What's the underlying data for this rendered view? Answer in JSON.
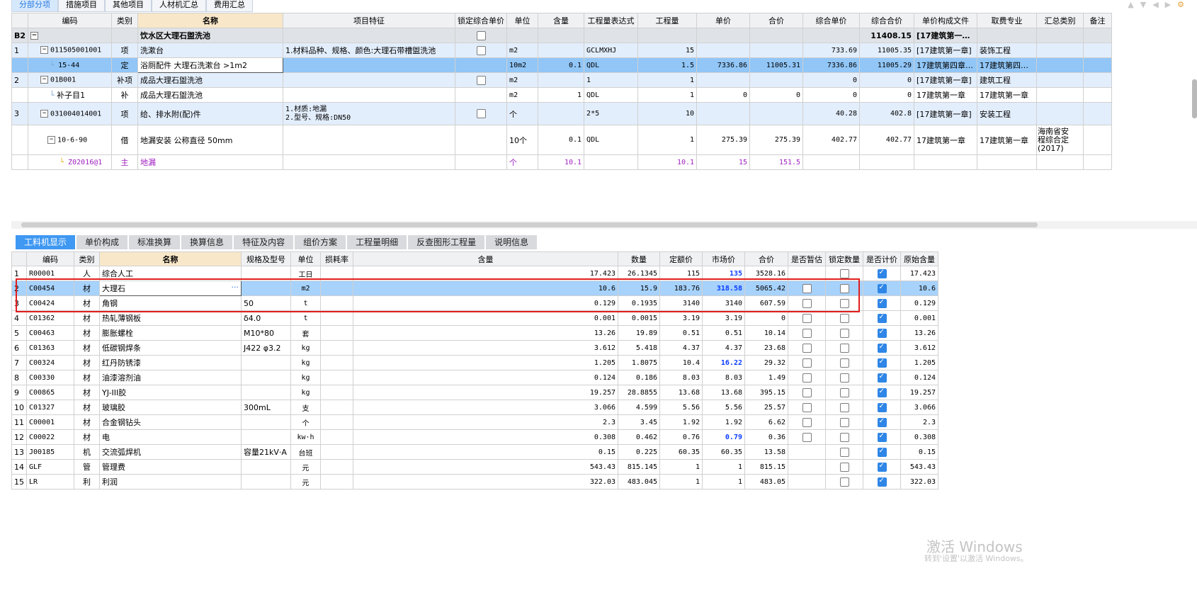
{
  "top_tabs": [
    "分部分项",
    "措施项目",
    "其他项目",
    "人材机汇总",
    "费用汇总"
  ],
  "top_table": {
    "headers": [
      "编码",
      "类别",
      "名称",
      "项目特征",
      "锁定综合单价",
      "单位",
      "含量",
      "工程量表达式",
      "工程量",
      "单价",
      "合价",
      "综合单价",
      "综合合价",
      "单价构成文件",
      "取费专业",
      "汇总类别",
      "备注"
    ],
    "group": {
      "idx": "B2",
      "name": "饮水区大理石盥洗池",
      "total": "11408.15",
      "file": "[17建筑第一…"
    },
    "rows": [
      {
        "idx": "1",
        "code": "011505001001",
        "type": "项",
        "name": "洗漱台",
        "feature": "1.材料品种、规格、颜色:大理石带槽盥洗池",
        "unit": "m2",
        "content": "",
        "expr": "GCLMXHJ",
        "qty": "15",
        "price": "",
        "total": "",
        "zh_price": "733.69",
        "zh_total": "11005.35",
        "file": "[17建筑第一章]",
        "major": "装饰工程",
        "note": ""
      },
      {
        "idx": "",
        "code": "15-44",
        "type": "定",
        "name": "浴厕配件 大理石洗漱台 >1m2",
        "feature": "",
        "unit": "10m2",
        "content": "0.1",
        "expr": "QDL",
        "qty": "1.5",
        "price": "7336.86",
        "total": "11005.31",
        "zh_price": "7336.86",
        "zh_total": "11005.29",
        "file": "17建筑第四章…",
        "major": "17建筑第四…",
        "note": ""
      },
      {
        "idx": "2",
        "code": "01B001",
        "type": "补项",
        "name": "成品大理石盥洗池",
        "feature": "",
        "unit": "m2",
        "content": "",
        "expr": "1",
        "qty": "1",
        "price": "",
        "total": "",
        "zh_price": "0",
        "zh_total": "0",
        "file": "[17建筑第一章]",
        "major": "建筑工程",
        "note": ""
      },
      {
        "idx": "",
        "code": "补子目1",
        "type": "补",
        "name": "成品大理石盥洗池",
        "feature": "",
        "unit": "m2",
        "content": "1",
        "expr": "QDL",
        "qty": "1",
        "price": "0",
        "total": "0",
        "zh_price": "0",
        "zh_total": "0",
        "file": "17建筑第一章",
        "major": "17建筑第一章",
        "note": ""
      },
      {
        "idx": "3",
        "code": "031004014001",
        "type": "项",
        "name": "给、排水附(配)件",
        "feature": "1.材质:地漏",
        "feature2": "2.型号、规格:DN50",
        "unit": "个",
        "content": "",
        "expr": "2*5",
        "qty": "10",
        "price": "",
        "total": "",
        "zh_price": "40.28",
        "zh_total": "402.8",
        "file": "[17建筑第一章]",
        "major": "安装工程",
        "note": ""
      },
      {
        "idx": "",
        "code": "10-6-90",
        "type": "借",
        "name": "地漏安装 公称直径 50mm",
        "feature": "",
        "unit": "10个",
        "content": "0.1",
        "expr": "QDL",
        "qty": "1",
        "price": "275.39",
        "total": "275.39",
        "zh_price": "402.77",
        "zh_total": "402.77",
        "file": "17建筑第一章",
        "major": "17建筑第一章",
        "note": "海南省安",
        "note2": "程综合定",
        "note3": "(2017)"
      },
      {
        "idx": "",
        "code": "Z02016@1",
        "type": "主",
        "name": "地漏",
        "feature": "",
        "unit": "个",
        "content": "10.1",
        "expr": "",
        "qty": "10.1",
        "price": "15",
        "total": "151.5",
        "zh_price": "",
        "zh_total": "",
        "file": "",
        "major": "",
        "note": ""
      }
    ]
  },
  "bottom_tabs": [
    "工料机显示",
    "单价构成",
    "标准换算",
    "换算信息",
    "特征及内容",
    "组价方案",
    "工程量明细",
    "反查图形工程量",
    "说明信息"
  ],
  "bottom_table": {
    "headers": [
      "编码",
      "类别",
      "名称",
      "规格及型号",
      "单位",
      "损耗率",
      "含量",
      "数量",
      "定额价",
      "市场价",
      "合价",
      "是否暂估",
      "锁定数量",
      "是否计价",
      "原始含量"
    ],
    "rows": [
      {
        "idx": "1",
        "code": "R00001",
        "type": "人",
        "name": "综合人工",
        "spec": "",
        "unit": "工日",
        "content": "17.423",
        "qty": "26.1345",
        "base": "115",
        "market": "135",
        "total": "3528.16",
        "zg": "",
        "sd": "off",
        "jj": "on",
        "orig": "17.423",
        "blue": true
      },
      {
        "idx": "2",
        "code": "C00454",
        "type": "材",
        "name": "大理石",
        "spec": "",
        "unit": "m2",
        "content": "10.6",
        "qty": "15.9",
        "base": "183.76",
        "market": "318.58",
        "total": "5065.42",
        "zg": "off",
        "sd": "off",
        "jj": "on",
        "orig": "10.6",
        "blue": true
      },
      {
        "idx": "3",
        "code": "C00424",
        "type": "材",
        "name": "角钢",
        "spec": "50",
        "unit": "t",
        "content": "0.129",
        "qty": "0.1935",
        "base": "3140",
        "market": "3140",
        "total": "607.59",
        "zg": "off",
        "sd": "off",
        "jj": "on",
        "orig": "0.129",
        "blue": false
      },
      {
        "idx": "4",
        "code": "C01362",
        "type": "材",
        "name": "热轧薄钢板",
        "spec": "δ4.0",
        "unit": "t",
        "content": "0.001",
        "qty": "0.0015",
        "base": "3.19",
        "market": "3.19",
        "total": "0",
        "zg": "off",
        "sd": "off",
        "jj": "on",
        "orig": "0.001",
        "blue": false
      },
      {
        "idx": "5",
        "code": "C00463",
        "type": "材",
        "name": "膨胀螺栓",
        "spec": "M10*80",
        "unit": "套",
        "content": "13.26",
        "qty": "19.89",
        "base": "0.51",
        "market": "0.51",
        "total": "10.14",
        "zg": "off",
        "sd": "off",
        "jj": "on",
        "orig": "13.26",
        "blue": false
      },
      {
        "idx": "6",
        "code": "C01363",
        "type": "材",
        "name": "低碳钢焊条",
        "spec": "J422 φ3.2",
        "unit": "kg",
        "content": "3.612",
        "qty": "5.418",
        "base": "4.37",
        "market": "4.37",
        "total": "23.68",
        "zg": "off",
        "sd": "off",
        "jj": "on",
        "orig": "3.612",
        "blue": false
      },
      {
        "idx": "7",
        "code": "C00324",
        "type": "材",
        "name": "红丹防锈漆",
        "spec": "",
        "unit": "kg",
        "content": "1.205",
        "qty": "1.8075",
        "base": "10.4",
        "market": "16.22",
        "total": "29.32",
        "zg": "off",
        "sd": "off",
        "jj": "on",
        "orig": "1.205",
        "blue": true
      },
      {
        "idx": "8",
        "code": "C00330",
        "type": "材",
        "name": "油漆溶剂油",
        "spec": "",
        "unit": "kg",
        "content": "0.124",
        "qty": "0.186",
        "base": "8.03",
        "market": "8.03",
        "total": "1.49",
        "zg": "off",
        "sd": "off",
        "jj": "on",
        "orig": "0.124",
        "blue": false
      },
      {
        "idx": "9",
        "code": "C00865",
        "type": "材",
        "name": "YJ-III胶",
        "spec": "",
        "unit": "kg",
        "content": "19.257",
        "qty": "28.8855",
        "base": "13.68",
        "market": "13.68",
        "total": "395.15",
        "zg": "off",
        "sd": "off",
        "jj": "on",
        "orig": "19.257",
        "blue": false
      },
      {
        "idx": "10",
        "code": "C01327",
        "type": "材",
        "name": "玻璃胶",
        "spec": "300mL",
        "unit": "支",
        "content": "3.066",
        "qty": "4.599",
        "base": "5.56",
        "market": "5.56",
        "total": "25.57",
        "zg": "off",
        "sd": "off",
        "jj": "on",
        "orig": "3.066",
        "blue": false
      },
      {
        "idx": "11",
        "code": "C00001",
        "type": "材",
        "name": "合金钢钻头",
        "spec": "",
        "unit": "个",
        "content": "2.3",
        "qty": "3.45",
        "base": "1.92",
        "market": "1.92",
        "total": "6.62",
        "zg": "off",
        "sd": "off",
        "jj": "on",
        "orig": "2.3",
        "blue": false
      },
      {
        "idx": "12",
        "code": "C00022",
        "type": "材",
        "name": "电",
        "spec": "",
        "unit": "kw·h",
        "content": "0.308",
        "qty": "0.462",
        "base": "0.76",
        "market": "0.79",
        "total": "0.36",
        "zg": "off",
        "sd": "off",
        "jj": "on",
        "orig": "0.308",
        "blue": true
      },
      {
        "idx": "13",
        "code": "J00185",
        "type": "机",
        "name": "交流弧焊机",
        "spec": "容量21kV·A",
        "unit": "台班",
        "content": "0.15",
        "qty": "0.225",
        "base": "60.35",
        "market": "60.35",
        "total": "13.58",
        "zg": "",
        "sd": "off",
        "jj": "on",
        "orig": "0.15",
        "blue": false
      },
      {
        "idx": "14",
        "code": "GLF",
        "type": "管",
        "name": "管理费",
        "spec": "",
        "unit": "元",
        "content": "543.43",
        "qty": "815.145",
        "base": "1",
        "market": "1",
        "total": "815.15",
        "zg": "",
        "sd": "off",
        "jj": "on",
        "orig": "543.43",
        "blue": false
      },
      {
        "idx": "15",
        "code": "LR",
        "type": "利",
        "name": "利润",
        "spec": "",
        "unit": "元",
        "content": "322.03",
        "qty": "483.045",
        "base": "1",
        "market": "1",
        "total": "483.05",
        "zg": "",
        "sd": "off",
        "jj": "on",
        "orig": "322.03",
        "blue": false
      }
    ]
  },
  "watermark": {
    "title": "激活 Windows",
    "sub": "转到'设置'以激活 Windows。"
  }
}
